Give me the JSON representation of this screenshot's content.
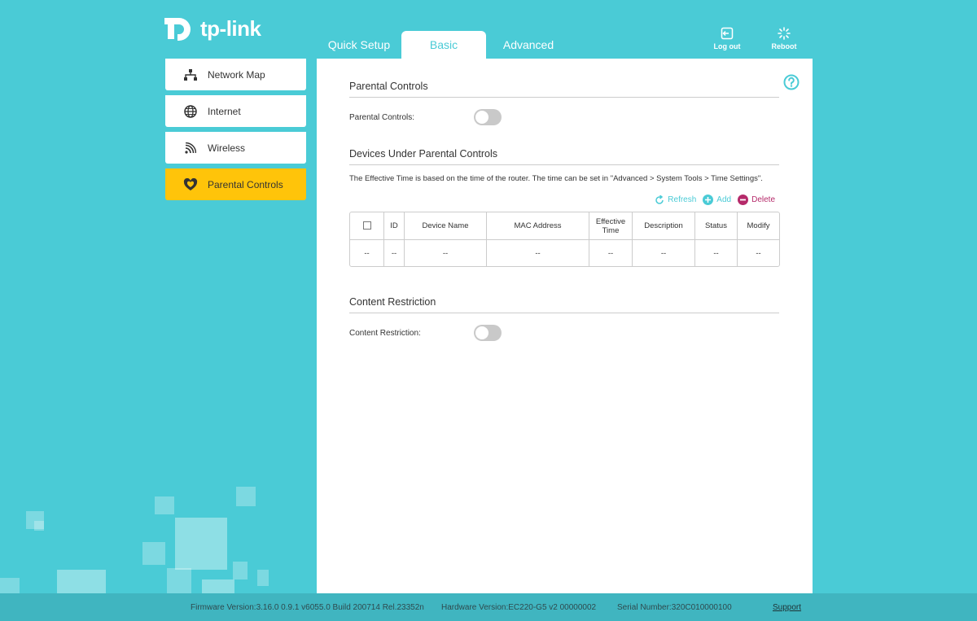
{
  "brand": {
    "name": "tp-link"
  },
  "tabs": [
    {
      "label": "Quick Setup"
    },
    {
      "label": "Basic"
    },
    {
      "label": "Advanced"
    }
  ],
  "top_actions": {
    "logout": "Log out",
    "reboot": "Reboot"
  },
  "sidebar": {
    "items": [
      {
        "label": "Network Map",
        "icon": "network-map-icon"
      },
      {
        "label": "Internet",
        "icon": "globe-icon"
      },
      {
        "label": "Wireless",
        "icon": "wifi-icon"
      },
      {
        "label": "Parental Controls",
        "icon": "heart-shield-icon"
      }
    ]
  },
  "parental": {
    "section_title": "Parental Controls",
    "toggle_label": "Parental Controls:"
  },
  "devices": {
    "section_title": "Devices Under Parental Controls",
    "note": "The Effective Time is based on the time of the router. The time can be set in \"Advanced > System Tools > Time Settings\".",
    "actions": {
      "refresh": "Refresh",
      "add": "Add",
      "delete": "Delete"
    },
    "columns": [
      "ID",
      "Device Name",
      "MAC Address",
      "Effective Time",
      "Description",
      "Status",
      "Modify"
    ],
    "row": [
      "--",
      "--",
      "--",
      "--",
      "--",
      "--",
      "--",
      "--"
    ]
  },
  "content": {
    "section_title": "Content Restriction",
    "toggle_label": "Content Restriction:"
  },
  "footer": {
    "firmware": "Firmware Version:3.16.0 0.9.1 v6055.0 Build 200714 Rel.23352n",
    "hardware": "Hardware Version:EC220-G5 v2 00000002",
    "serial": "Serial Number:320C010000100",
    "support": "Support"
  },
  "colors": {
    "accent": "#4acbd6",
    "active_nav": "#ffc40a",
    "delete": "#b52a6a",
    "toggle_off": "#c9c9c9"
  }
}
